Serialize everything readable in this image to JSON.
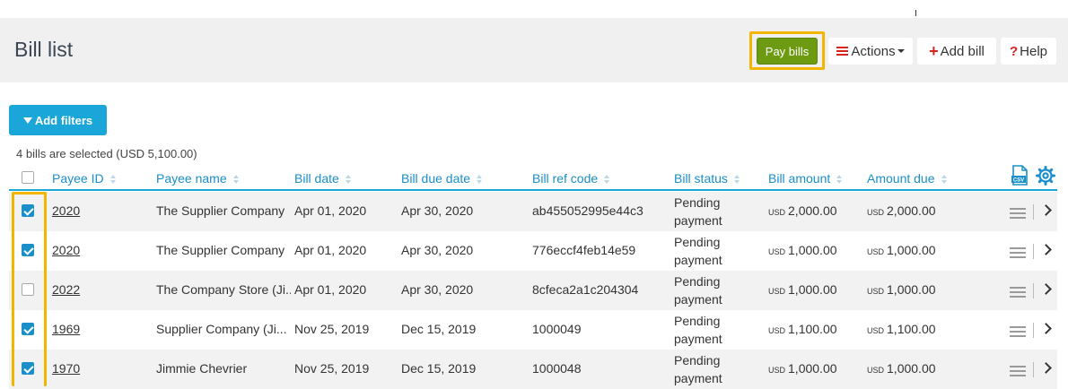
{
  "header": {
    "title": "Bill list",
    "pay_bills": "Pay bills",
    "actions": "Actions",
    "add_bill": "Add bill",
    "help": "Help"
  },
  "toolbar": {
    "add_filters": "Add filters",
    "selected_info": "4 bills are selected (USD 5,100.00)"
  },
  "columns": {
    "payee_id": "Payee ID",
    "payee_name": "Payee name",
    "bill_date": "Bill date",
    "bill_due_date": "Bill due date",
    "bill_ref_code": "Bill ref code",
    "bill_status": "Bill status",
    "bill_amount": "Bill amount",
    "amount_due": "Amount due"
  },
  "icons": {
    "csv": "csv-export-icon",
    "settings": "gear-icon",
    "csv_label": "CSV"
  },
  "colors": {
    "accent": "#1aa6d8",
    "pay_button": "#6c9a11",
    "highlight": "#f2b500",
    "danger": "#d9231d"
  },
  "rows": [
    {
      "checked": true,
      "payee_id": "2020",
      "payee_name": "The Supplier Company",
      "bill_date": "Apr 01, 2020",
      "due_date": "Apr 30, 2020",
      "ref_code": "ab455052995e44c3",
      "status": "Pending payment",
      "currency": "USD",
      "bill_amount": "2,000.00",
      "amount_due": "2,000.00"
    },
    {
      "checked": true,
      "payee_id": "2020",
      "payee_name": "The Supplier Company",
      "bill_date": "Apr 01, 2020",
      "due_date": "Apr 30, 2020",
      "ref_code": "776eccf4feb14e59",
      "status": "Pending payment",
      "currency": "USD",
      "bill_amount": "1,000.00",
      "amount_due": "1,000.00"
    },
    {
      "checked": false,
      "payee_id": "2022",
      "payee_name": "The Company Store (Ji...",
      "bill_date": "Apr 01, 2020",
      "due_date": "Apr 30, 2020",
      "ref_code": "8cfeca2a1c204304",
      "status": "Pending payment",
      "currency": "USD",
      "bill_amount": "1,000.00",
      "amount_due": "1,000.00"
    },
    {
      "checked": true,
      "payee_id": "1969",
      "payee_name": "Supplier Company (Ji...",
      "bill_date": "Nov 25, 2019",
      "due_date": "Dec 15, 2019",
      "ref_code": "1000049",
      "status": "Pending payment",
      "currency": "USD",
      "bill_amount": "1,100.00",
      "amount_due": "1,100.00"
    },
    {
      "checked": true,
      "payee_id": "1970",
      "payee_name": "Jimmie Chevrier",
      "bill_date": "Nov 25, 2019",
      "due_date": "Dec 15, 2019",
      "ref_code": "1000048",
      "status": "Pending payment",
      "currency": "USD",
      "bill_amount": "1,000.00",
      "amount_due": "1,000.00"
    }
  ]
}
